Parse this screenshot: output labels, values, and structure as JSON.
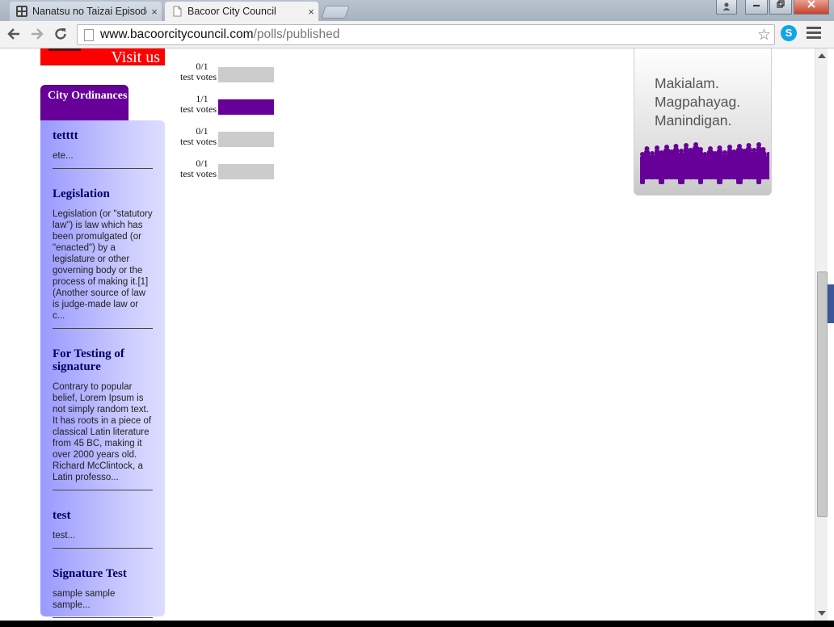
{
  "browser": {
    "tabs": [
      {
        "title": "Nanatsu no Taizai Episode",
        "active": false
      },
      {
        "title": "Bacoor City Council",
        "active": true
      }
    ],
    "url_host": "www.bacoorcitycouncil.com",
    "url_path": "/polls/published",
    "close_glyph": "×"
  },
  "page": {
    "banner": {
      "text": "Visit us"
    },
    "ordinances": {
      "tab_title": "City Ordinances",
      "items": [
        {
          "title": "tetttt",
          "excerpt": "ete..."
        },
        {
          "title": "Legislation",
          "excerpt": "Legislation (or \"statutory law\") is law which has been promulgated (or \"enacted\") by a legislature or other governing body or the process of making it.[1] (Another source of law is judge-made law or c..."
        },
        {
          "title": "For Testing of signature",
          "excerpt": "Contrary to popular belief, Lorem Ipsum is not simply random text. It has roots in a piece of classical Latin literature from 45 BC, making it over 2000 years old. Richard McClintock, a Latin professo..."
        },
        {
          "title": "test",
          "excerpt": "test..."
        },
        {
          "title": "Signature Test",
          "excerpt": "sample sample sample..."
        }
      ]
    },
    "polls": [
      {
        "count": "0/1",
        "label": "test votes",
        "fraction": 0
      },
      {
        "count": "1/1",
        "label": "test votes",
        "fraction": 1
      },
      {
        "count": "0/1",
        "label": "test votes",
        "fraction": 0
      },
      {
        "count": "0/1",
        "label": "test votes",
        "fraction": 0
      }
    ],
    "promo": {
      "lines": [
        "Makialam.",
        "Magpahayag.",
        "Manindigan."
      ],
      "crowd_color": "#660099"
    }
  },
  "colors": {
    "accent_purple": "#660099",
    "banner_red": "#ff0000",
    "bar_empty": "#cccccc"
  },
  "icons": {
    "back": "arrow-left-icon",
    "forward": "arrow-right-icon",
    "reload": "reload-icon",
    "star": "star-icon",
    "skype": "skype-icon",
    "menu": "hamburger-menu-icon"
  }
}
